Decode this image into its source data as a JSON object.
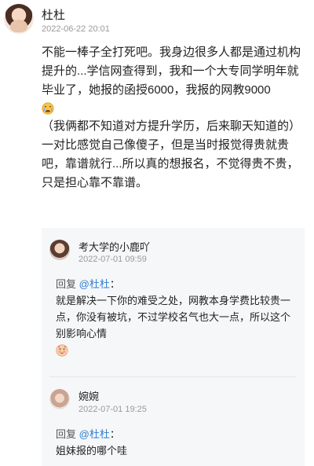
{
  "post": {
    "author": "杜杜",
    "time": "2022-06-22 20:01",
    "paragraph1": "不能一棒子全打死吧。我身边很多人都是通过机构提升的...学信网查得到，我和一个大专同学明年就毕业了，她报的函授6000，我报的网教9000",
    "paragraph2": "（我俩都不知道对方提升学历，后来聊天知道的）一对比感觉自己像傻子，但是当时报觉得贵就贵吧，靠谱就行...所以真的想报名，不觉得贵不贵，只是担心靠不靠谱。",
    "emoji_name": "crying-emoji-icon"
  },
  "replies": [
    {
      "author": "考大学的小鹿吖",
      "time": "2022-07-01 09:59",
      "reply_word": "回复",
      "mention": "@杜杜",
      "colon": "：",
      "text": "就是解决一下你的难受之处，网教本身学费比较贵一点，你没有被坑，不过学校名气也大一点，所以这个别影响心情",
      "emoji_name": "blush-emoji-icon"
    },
    {
      "author": "婉婉",
      "time": "2022-07-01 19:25",
      "reply_word": "回复",
      "mention": "@杜杜",
      "colon": "：",
      "text": "姐妹报的哪个哇"
    }
  ],
  "colors": {
    "mention": "#2e7dd1",
    "reply_box_bg": "#f6f7f8",
    "meta_text": "#9a9a9a"
  }
}
